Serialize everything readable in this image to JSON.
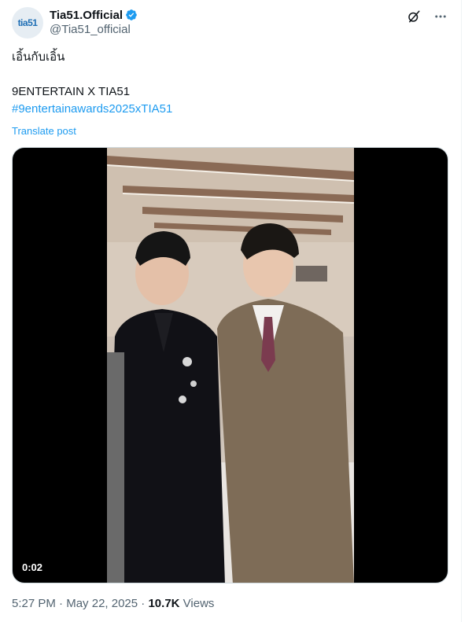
{
  "author": {
    "avatar_text": "tia51",
    "display_name": "Tia51.Official",
    "handle": "@Tia51_official"
  },
  "post": {
    "line1": "เอิ้นกับเอิ้น",
    "line2": "9ENTERTAIN X TIA51",
    "hashtag": "#9entertainawards2025xTIA51",
    "translate_label": "Translate post"
  },
  "video": {
    "duration": "0:02"
  },
  "meta": {
    "time": "5:27 PM",
    "separator": "·",
    "date": "May 22, 2025",
    "views_count": "10.7K",
    "views_label": "Views"
  },
  "colors": {
    "link": "#1d9bf0",
    "secondary_text": "#536471",
    "primary_text": "#0f1419",
    "verified": "#1d9bf0"
  },
  "icons": [
    "verified-badge-icon",
    "grok-icon",
    "more-icon"
  ]
}
